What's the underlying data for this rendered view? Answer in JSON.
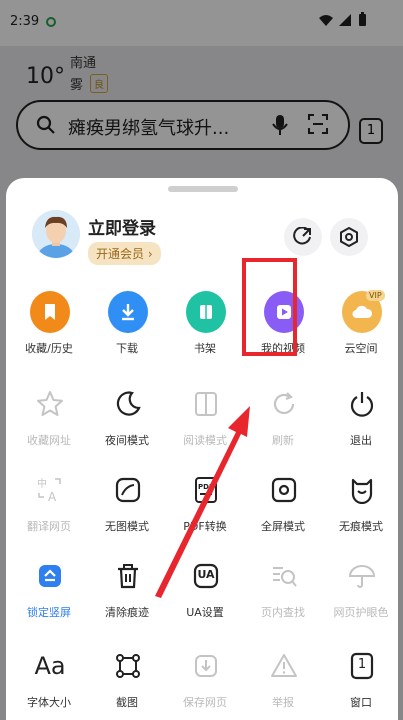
{
  "status_bar": {
    "time": "2:39"
  },
  "background": {
    "weather": {
      "temp": "10°",
      "location": "南通",
      "condition": "雾",
      "aqi": "良"
    },
    "search": {
      "query": "瘫痪男绑氢气球升..."
    },
    "tab_count": "1"
  },
  "sheet": {
    "login_label": "立即登录",
    "vip_label": "开通会员 ›",
    "rows": [
      [
        {
          "label": "收藏/历史",
          "icon": "bookmark-icon"
        },
        {
          "label": "下载",
          "icon": "download-icon"
        },
        {
          "label": "书架",
          "icon": "bookshelf-icon"
        },
        {
          "label": "我的视频",
          "icon": "video-play-icon"
        },
        {
          "label": "云空间",
          "icon": "cloud-icon",
          "badge": "VIP"
        }
      ],
      [
        {
          "label": "收藏网址",
          "icon": "star-icon"
        },
        {
          "label": "夜间模式",
          "icon": "moon-icon"
        },
        {
          "label": "阅读模式",
          "icon": "read-mode-icon"
        },
        {
          "label": "刷新",
          "icon": "refresh-icon"
        },
        {
          "label": "退出",
          "icon": "power-icon"
        }
      ],
      [
        {
          "label": "翻译网页",
          "icon": "translate-icon"
        },
        {
          "label": "无图模式",
          "icon": "no-image-icon"
        },
        {
          "label": "PDF转换",
          "icon": "pdf-icon"
        },
        {
          "label": "全屏模式",
          "icon": "fullscreen-icon"
        },
        {
          "label": "无痕模式",
          "icon": "incognito-icon"
        }
      ],
      [
        {
          "label": "锁定竖屏",
          "icon": "lock-portrait-icon"
        },
        {
          "label": "清除痕迹",
          "icon": "trash-icon"
        },
        {
          "label": "UA设置",
          "icon": "ua-icon",
          "icon_text": "UA"
        },
        {
          "label": "页内查找",
          "icon": "find-in-page-icon"
        },
        {
          "label": "网页护眼色",
          "icon": "umbrella-icon"
        }
      ],
      [
        {
          "label": "字体大小",
          "icon": "font-size-icon",
          "icon_text": "Aa"
        },
        {
          "label": "截图",
          "icon": "screenshot-icon"
        },
        {
          "label": "保存网页",
          "icon": "save-page-icon"
        },
        {
          "label": "举报",
          "icon": "report-icon"
        },
        {
          "label": "窗口",
          "icon": "window-icon",
          "icon_text": "1"
        }
      ]
    ]
  },
  "colors": {
    "orange": "#f28a1a",
    "blue": "#2f8ff5",
    "teal": "#1fc3a4",
    "purple": "#8a5cf6",
    "gold": "#f3b64e",
    "highlight": "#e8262e"
  }
}
